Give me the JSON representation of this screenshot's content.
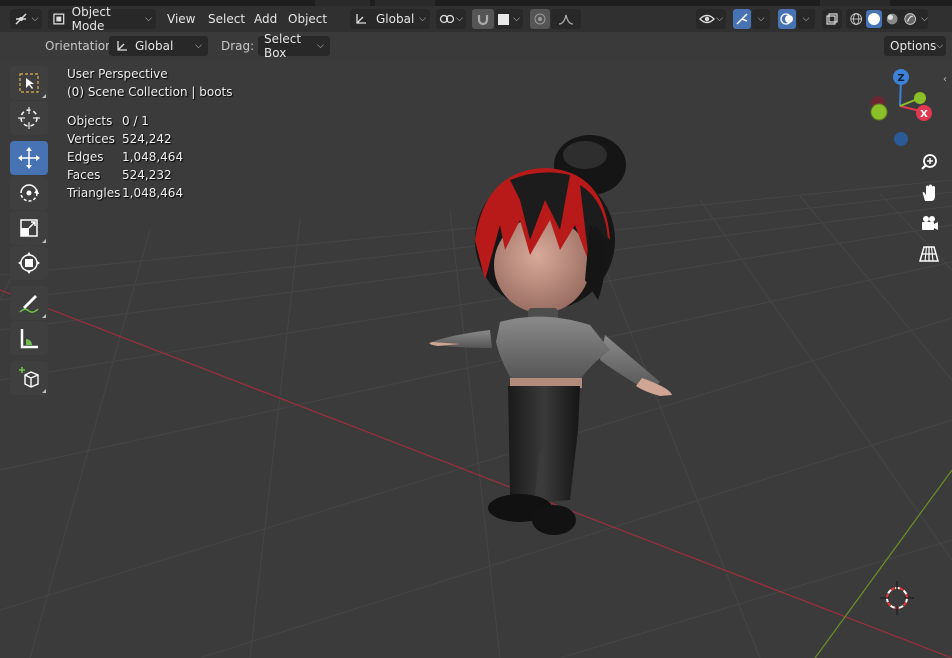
{
  "header": {
    "editor_type_icon": "3d-viewport-icon",
    "mode_label": "Object Mode",
    "menus": [
      "View",
      "Select",
      "Add",
      "Object"
    ],
    "transform_orientation": "Global",
    "pivot_icon": "pivot-point-icon",
    "snap_icon": "snap-magnet-icon",
    "proportional_icon": "proportional-editing-icon"
  },
  "tool_settings": {
    "orientation_label": "Orientation:",
    "orientation_value": "Global",
    "drag_label": "Drag:",
    "drag_value": "Select Box",
    "options_label": "Options"
  },
  "viewport_info": {
    "view_name": "User Perspective",
    "collection_line": "(0) Scene Collection | boots",
    "stats": [
      {
        "label": "Objects",
        "value": "0 / 1"
      },
      {
        "label": "Vertices",
        "value": "524,242"
      },
      {
        "label": "Edges",
        "value": "1,048,464"
      },
      {
        "label": "Faces",
        "value": "524,232"
      },
      {
        "label": "Triangles",
        "value": "1,048,464"
      }
    ]
  },
  "tools": [
    {
      "name": "select-box-tool",
      "icon": "select-box-icon",
      "active": false
    },
    {
      "name": "cursor-tool",
      "icon": "cursor-icon",
      "active": false
    },
    {
      "name": "move-tool",
      "icon": "move-icon",
      "active": true
    },
    {
      "name": "rotate-tool",
      "icon": "rotate-icon",
      "active": false
    },
    {
      "name": "scale-tool",
      "icon": "scale-icon",
      "active": false
    },
    {
      "name": "transform-tool",
      "icon": "transform-icon",
      "active": false
    },
    {
      "name": "annotate-tool",
      "icon": "annotate-icon",
      "active": false
    },
    {
      "name": "measure-tool",
      "icon": "measure-icon",
      "active": false
    },
    {
      "name": "add-cube-tool",
      "icon": "add-cube-icon",
      "active": false
    }
  ],
  "gizmo": {
    "x_label": "X",
    "y_label": "Y",
    "z_label": "Z"
  },
  "colors": {
    "accent_blue": "#4772b3",
    "axis_x": "#e0394f",
    "axis_y": "#8bbf2a",
    "axis_z": "#3d82d8",
    "grid": "#454545",
    "background": "#3b3b3b"
  }
}
